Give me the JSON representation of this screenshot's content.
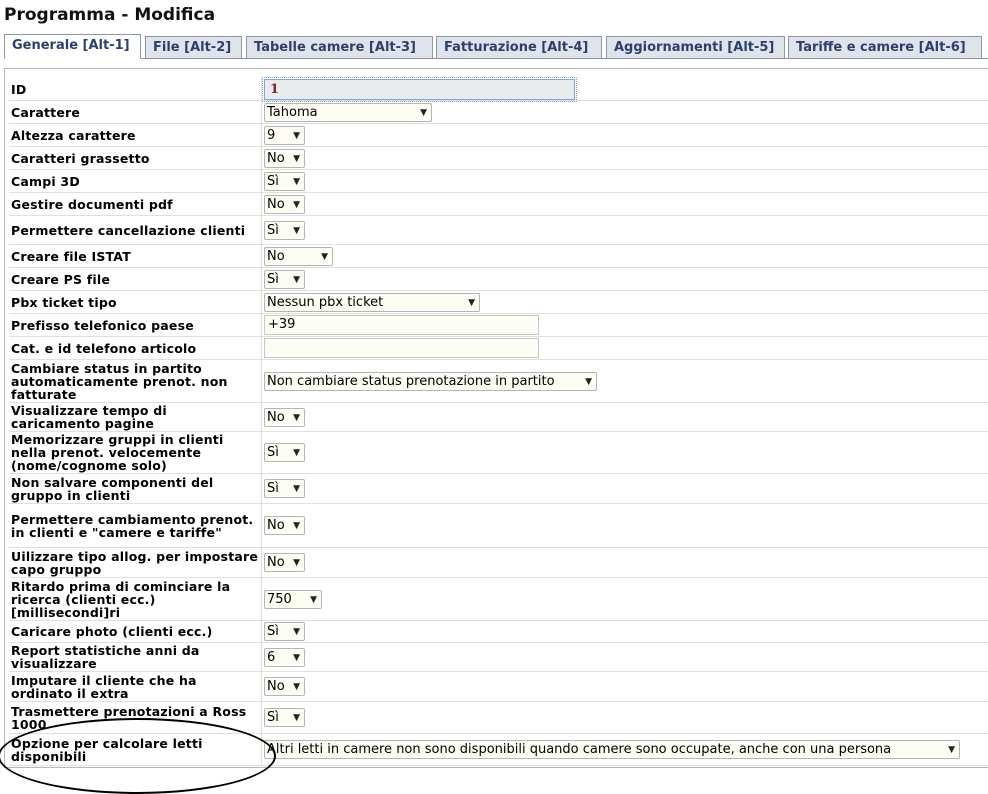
{
  "title": "Programma - Modifica",
  "tabs": [
    {
      "label": "Generale [Alt-1]",
      "active": true
    },
    {
      "label": "File [Alt-2]",
      "active": false
    },
    {
      "label": "Tabelle camere [Alt-3]",
      "active": false
    },
    {
      "label": "Fatturazione [Alt-4]",
      "active": false
    },
    {
      "label": "Aggiornamenti [Alt-5]",
      "active": false
    },
    {
      "label": "Tariffe e camere [Alt-6]",
      "active": false
    }
  ],
  "rows": [
    {
      "label": "ID",
      "type": "id",
      "value": "1"
    },
    {
      "label": "Carattere",
      "type": "select",
      "value": "Tahoma"
    },
    {
      "label": "Altezza carattere",
      "type": "select",
      "value": "9"
    },
    {
      "label": "Caratteri grassetto",
      "type": "select",
      "value": "No"
    },
    {
      "label": "Campi 3D",
      "type": "select",
      "value": "Sì"
    },
    {
      "label": "Gestire documenti pdf",
      "type": "select",
      "value": "No"
    },
    {
      "label": "Permettere cancellazione clienti",
      "type": "select",
      "value": "Sì"
    },
    {
      "label": "Creare file ISTAT",
      "type": "select",
      "value": "No"
    },
    {
      "label": "Creare PS file",
      "type": "select",
      "value": "Sì"
    },
    {
      "label": "Pbx ticket tipo",
      "type": "select",
      "value": "Nessun pbx ticket"
    },
    {
      "label": "Prefisso telefonico paese",
      "type": "input",
      "value": "+39"
    },
    {
      "label": "Cat. e id telefono articolo",
      "type": "input",
      "value": ""
    },
    {
      "label": "Cambiare status in partito automaticamente prenot. non fatturate",
      "type": "select",
      "value": "Non cambiare status prenotazione in partito"
    },
    {
      "label": "Visualizzare tempo di caricamento pagine",
      "type": "select",
      "value": "No"
    },
    {
      "label": "Memorizzare gruppi in clienti nella prenot. velocemente (nome/cognome solo)",
      "type": "select",
      "value": "Sì"
    },
    {
      "label": "Non salvare componenti del gruppo in clienti",
      "type": "select",
      "value": "Sì"
    },
    {
      "label": "Permettere cambiamento prenot. in clienti e \"camere e tariffe\"",
      "type": "select",
      "value": "No"
    },
    {
      "label": "Uilizzare tipo allog. per impostare capo gruppo",
      "type": "select",
      "value": "No"
    },
    {
      "label": "Ritardo prima di cominciare la ricerca (clienti ecc.) [millisecondi]ri",
      "type": "select",
      "value": "750"
    },
    {
      "label": "Caricare photo (clienti ecc.)",
      "type": "select",
      "value": "Sì"
    },
    {
      "label": "Report statistiche anni da visualizzare",
      "type": "select",
      "value": "6"
    },
    {
      "label": "Imputare il cliente che ha ordinato il extra",
      "type": "select",
      "value": "No"
    },
    {
      "label": "Trasmettere prenotazioni a Ross 1000",
      "type": "select",
      "value": "Sì"
    },
    {
      "label": "Opzione per calcolare letti disponibili",
      "type": "select",
      "value": "Altri letti in camere non sono disponibili quando camere sono occupate, anche con una persona"
    }
  ]
}
